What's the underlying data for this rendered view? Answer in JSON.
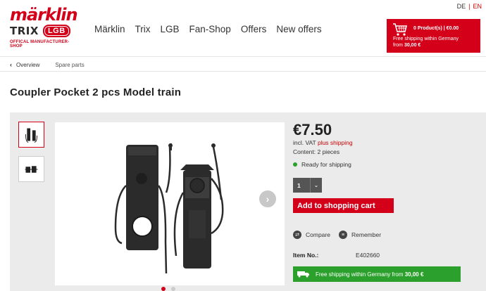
{
  "language": {
    "de": "DE",
    "separator": "|",
    "en": "EN"
  },
  "logo": {
    "brand": "märklin",
    "trix": "TRIX",
    "lgb": "LGB",
    "tagline": "OFFICAL MANUFACTURER-SHOP"
  },
  "nav": {
    "items": [
      "Märklin",
      "Trix",
      "LGB",
      "Fan-Shop",
      "Offers",
      "New offers"
    ]
  },
  "cart": {
    "summary": "0 Product(s) | €0.00",
    "shipping_text": "Free shipping within Germany",
    "shipping_from": "from",
    "shipping_amount": "30,00 €"
  },
  "breadcrumb": {
    "items": [
      "Overview",
      "Spare parts"
    ]
  },
  "product": {
    "title": "Coupler Pocket 2 pcs Model train",
    "price": "€7.50",
    "vat_prefix": "incl. VAT",
    "vat_link": "plus shipping",
    "content": "Content: 2 pieces",
    "availability": "Ready for shipping",
    "quantity": "1",
    "add_to_cart": "Add to shopping cart",
    "compare": "Compare",
    "remember": "Remember",
    "item_no_label": "Item No.:",
    "item_no_value": "E402660",
    "free_shipping": "Free shipping within Germany from",
    "free_shipping_amount": "30,00 €"
  },
  "gallery": {
    "active_index": 0,
    "count": 2
  },
  "colors": {
    "brand_red": "#d4001a",
    "green": "#2ca02c",
    "panel_gray": "#ebebeb"
  }
}
